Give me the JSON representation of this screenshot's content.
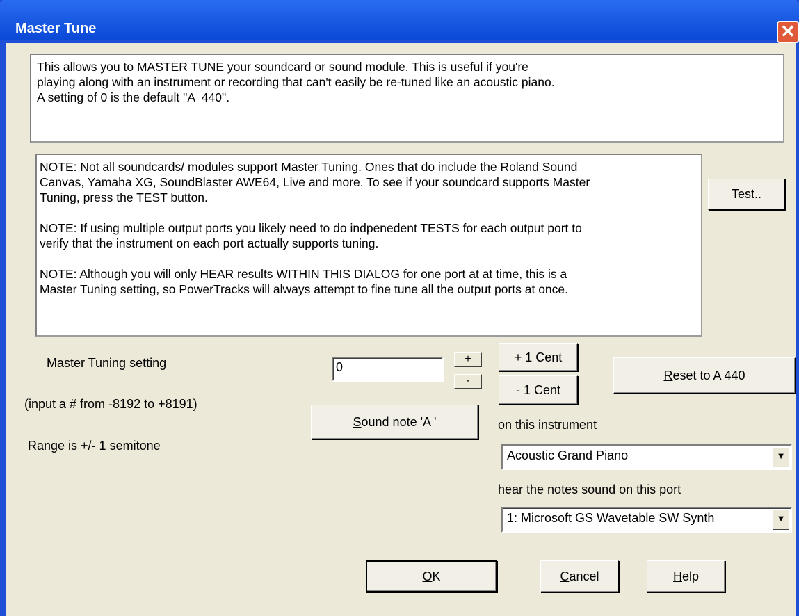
{
  "window": {
    "title": "Master Tune",
    "close_glyph": "✕"
  },
  "intro_text": "This allows you to MASTER TUNE your soundcard or sound module. This is useful if you're\nplaying along with an instrument or recording that can't easily be re-tuned like an acoustic piano.\nA setting of 0 is the default \"A  440\".",
  "notes_text": "NOTE: Not all soundcards/ modules support Master Tuning. Ones that do include the Roland Sound\nCanvas, Yamaha XG, SoundBlaster AWE64, Live and more. To see if your soundcard supports Master\nTuning, press the TEST button.\n\nNOTE: If using multiple output ports you likely need to do indpenedent TESTS for each output port to\nverify that the instrument on each port actually supports tuning.\n\nNOTE: Although you will only HEAR results WITHIN THIS DIALOG for one port at at time, this is a\nMaster Tuning setting, so PowerTracks will always attempt to fine tune all the output ports at once.",
  "buttons": {
    "test": "Test..",
    "plus": "+",
    "minus": "-",
    "plus_cent": "+ 1 Cent",
    "minus_cent": "- 1 Cent",
    "reset_mnemonic": "R",
    "reset_rest": "eset to A 440",
    "sound_mnemonic": "S",
    "sound_rest": "ound note 'A '",
    "ok_mnemonic": "O",
    "ok_rest": "K",
    "cancel_mnemonic": "C",
    "cancel_rest": "ancel",
    "help_mnemonic": "H",
    "help_rest": "elp"
  },
  "tuning": {
    "label_mnemonic": "M",
    "label_rest": "aster Tuning setting",
    "value": "0",
    "input_hint": "(input a # from -8192 to +8191)",
    "range_text": "Range is +/- 1 semitone"
  },
  "instrument": {
    "label": "on this instrument",
    "selected": "Acoustic Grand Piano"
  },
  "port": {
    "label": "hear the notes sound on this port",
    "selected": "1: Microsoft GS Wavetable SW Synth"
  },
  "icons": {
    "dropdown": "▼"
  }
}
